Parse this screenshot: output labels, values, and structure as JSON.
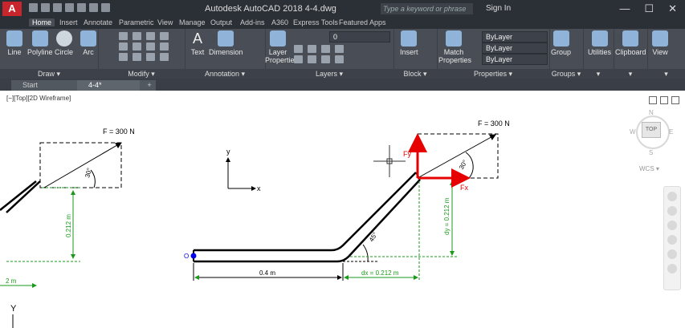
{
  "titlebar": {
    "logo": "A",
    "title": "Autodesk AutoCAD 2018    4-4.dwg",
    "search_placeholder": "Type a keyword or phrase",
    "signin": "Sign In",
    "minimize": "—",
    "maximize": "☐",
    "close": "✕"
  },
  "ribbon_tabs": [
    "Home",
    "Insert",
    "Annotate",
    "Parametric",
    "View",
    "Manage",
    "Output",
    "Add-ins",
    "A360",
    "Express Tools",
    "Featured Apps"
  ],
  "draw": {
    "line": "Line",
    "polyline": "Polyline",
    "circle": "Circle",
    "arc": "Arc",
    "panel": "Draw ▾"
  },
  "modify": {
    "panel": "Modify ▾"
  },
  "annotation": {
    "text": "Text",
    "dimension": "Dimension",
    "panel": "Annotation ▾"
  },
  "layers": {
    "layer_properties": "Layer Properties",
    "current_layer": "0",
    "panel": "Layers ▾"
  },
  "block": {
    "insert": "Insert",
    "panel": "Block ▾"
  },
  "properties": {
    "match": "Match Properties",
    "bylayer1": "ByLayer",
    "bylayer2": "ByLayer",
    "bylayer3": "ByLayer",
    "panel": "Properties ▾"
  },
  "groups": {
    "group": "Group",
    "panel": "Groups ▾"
  },
  "utilities": {
    "label": "Utilities"
  },
  "clipboard": {
    "label": "Clipboard"
  },
  "view": {
    "label": "View"
  },
  "doc_tabs": [
    "Start",
    "4-4*"
  ],
  "viewport_label": "[−][Top][2D Wireframe]",
  "viewcube": {
    "n": "N",
    "s": "S",
    "e": "E",
    "w": "W",
    "top": "TOP",
    "wcs": "WCS ▾"
  },
  "drawing": {
    "force_left": "F = 300 N",
    "force_right": "F = 300 N",
    "angle_left": "30°",
    "angle_right": "30°",
    "angle_bend": "45°",
    "dim_left_vertical": "0.212 m",
    "dim_left_horizontal": "2 m",
    "dim_horizontal": "0.4 m",
    "dim_dx": "dx = 0.212 m",
    "dim_dy": "dy = 0.212 m",
    "origin": "O",
    "fx": "Fx",
    "fy": "Fy",
    "axis_x": "x",
    "axis_y": "y",
    "ucs_y": "Y"
  },
  "colors": {
    "force_red": "#e60000",
    "dim_green": "#1a9a1a",
    "origin_blue": "#0000e6"
  }
}
